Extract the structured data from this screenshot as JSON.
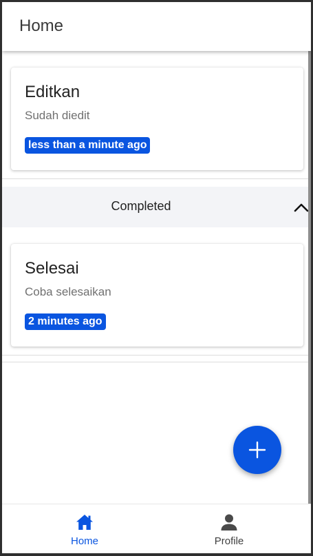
{
  "app_bar": {
    "title": "Home"
  },
  "tasks": [
    {
      "title": "Editkan",
      "description": "Sudah diedit",
      "time": "less than a minute ago"
    }
  ],
  "completed_section": {
    "label": "Completed",
    "expanded": true,
    "tasks": [
      {
        "title": "Selesai",
        "description": "Coba selesaikan",
        "time": "2 minutes ago"
      }
    ]
  },
  "fab": {
    "icon": "plus-icon"
  },
  "bottom_nav": {
    "items": [
      {
        "label": "Home",
        "icon": "home-icon",
        "active": true
      },
      {
        "label": "Profile",
        "icon": "person-icon",
        "active": false
      }
    ]
  },
  "colors": {
    "accent": "#0a55e0",
    "section_bg": "#f3f4f7",
    "frame": "#2f2f2f"
  }
}
